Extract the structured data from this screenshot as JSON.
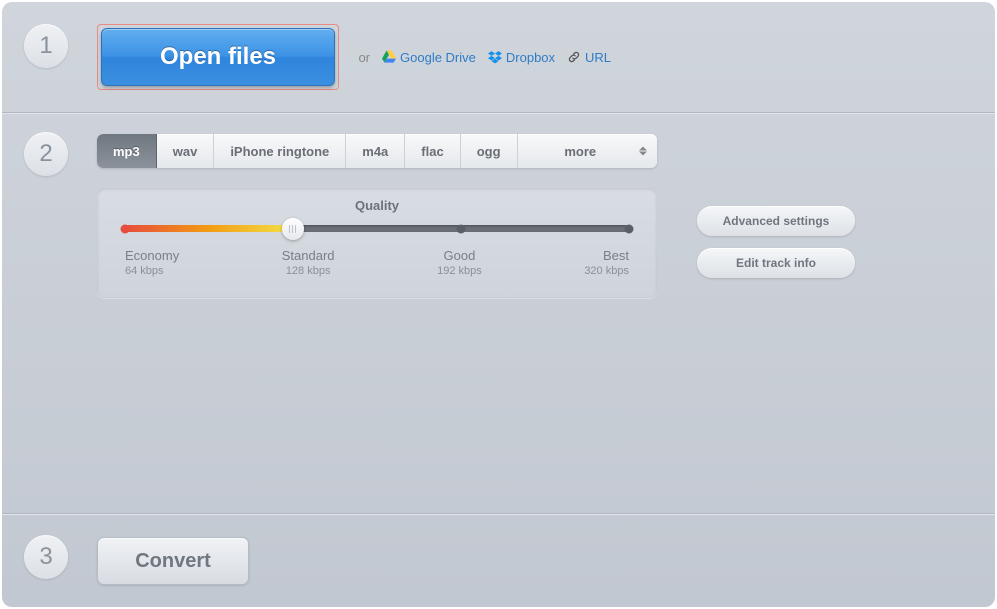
{
  "step1": {
    "number": "1",
    "open_label": "Open files",
    "or_label": "or",
    "sources": {
      "google_drive": "Google Drive",
      "dropbox": "Dropbox",
      "url": "URL"
    }
  },
  "step2": {
    "number": "2",
    "tabs": [
      "mp3",
      "wav",
      "iPhone ringtone",
      "m4a",
      "flac",
      "ogg",
      "more"
    ],
    "quality": {
      "title": "Quality",
      "levels": [
        {
          "name": "Economy",
          "rate": "64 kbps"
        },
        {
          "name": "Standard",
          "rate": "128 kbps"
        },
        {
          "name": "Good",
          "rate": "192 kbps"
        },
        {
          "name": "Best",
          "rate": "320 kbps"
        }
      ]
    },
    "buttons": {
      "advanced": "Advanced settings",
      "edit_track": "Edit track info"
    }
  },
  "step3": {
    "number": "3",
    "convert_label": "Convert"
  }
}
